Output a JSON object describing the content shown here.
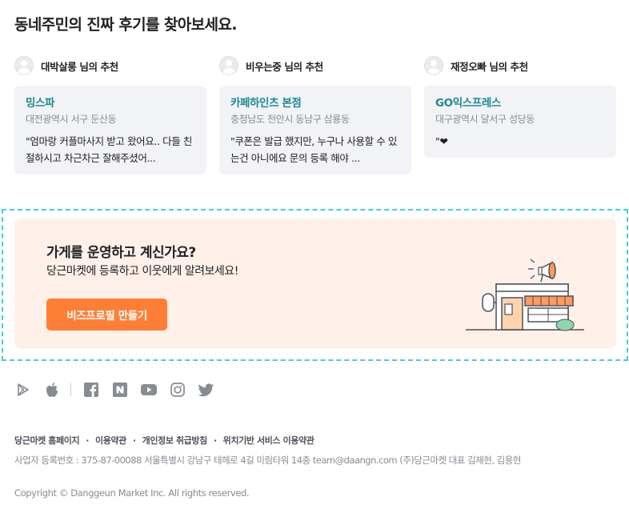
{
  "section_title": "동네주민의 진짜 후기를 찾아보세요.",
  "reviews": [
    {
      "reviewer": "대박살롱",
      "suffix": "님의 추천",
      "shop": "밍스파",
      "address": "대전광역시 서구 둔산동",
      "text": "\"엄마랑 커플마사지 받고 왔어요.. 다들 친절하시고 차근차근 잘해주셨어..."
    },
    {
      "reviewer": "비우는중",
      "suffix": "님의 추천",
      "shop": "카페하인츠 본점",
      "address": "충청남도 천안시 동남구 삼룡동",
      "text": "\"쿠폰은 발급 했지만, 누구나 사용할 수 있는건 아니에요 문의 등록 해야 ..."
    },
    {
      "reviewer": "재정오빠",
      "suffix": "님의 추천",
      "shop": "GO익스프레스",
      "address": "대구광역시 달서구 성당동",
      "text": "\"❤"
    }
  ],
  "banner": {
    "title": "가게를 운영하고 계신가요?",
    "description": "당근마켓에 등록하고 이웃에게 알려보세요!",
    "button_label": "비즈프로필 만들기"
  },
  "social_icons": [
    "google-play-icon",
    "apple-icon",
    "facebook-icon",
    "naver-blog-icon",
    "youtube-icon",
    "instagram-icon",
    "twitter-icon"
  ],
  "footer": {
    "links": [
      "당근마켓 홈페이지",
      "이용약관",
      "개인정보 취급방침",
      "위치기반 서비스 이용약관"
    ],
    "separator": "·",
    "business_info": "사업자 등록번호 : 375-87-00088 서울특별시 강남구 테헤로 4길 미림타워 14층 team@daangn.com (주)당근마켓 대표 김재현, 김용현",
    "copyright": "Copyright © Danggeun Market Inc. All rights reserved."
  },
  "colors": {
    "accent": "#ff7e36",
    "shop_name": "#1a8a92",
    "banner_bg": "#fff1ea",
    "card_bg": "#f2f3f6"
  }
}
